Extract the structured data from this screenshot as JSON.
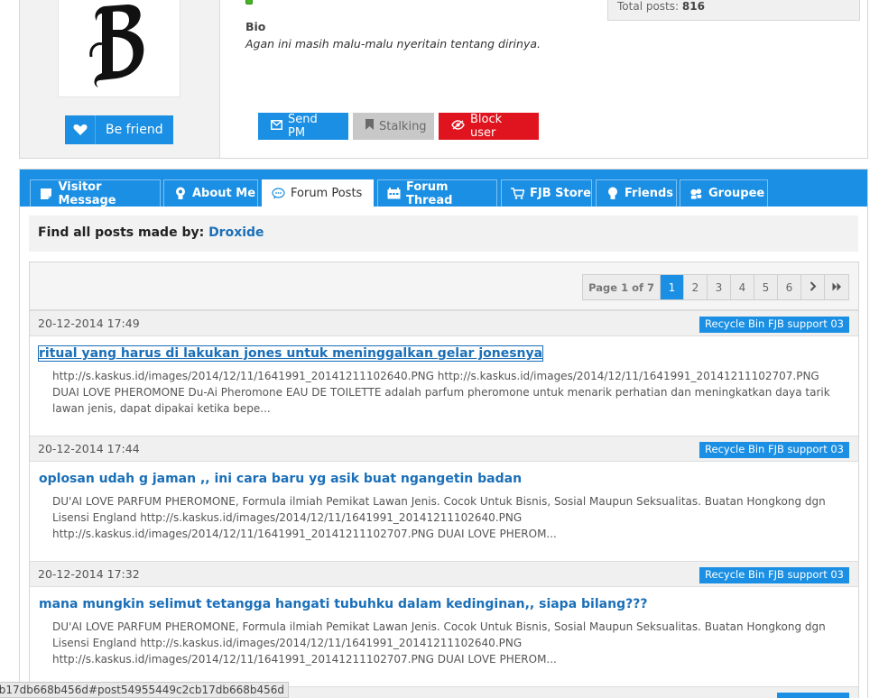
{
  "profile": {
    "bio_label": "Bio",
    "bio_text": "Agan ini masih malu-malu nyeritain tentang dirinya.",
    "stats_label": "Total posts:",
    "stats_value": "816",
    "befriend_label": "Be friend",
    "actions": {
      "send_pm": "Send PM",
      "stalking": "Stalking",
      "block_user": "Block user"
    }
  },
  "tabs": [
    {
      "label": "Visitor Message",
      "icon": "note-icon"
    },
    {
      "label": "About Me",
      "icon": "bulb-icon"
    },
    {
      "label": "Forum Posts",
      "icon": "chat-icon",
      "active": true
    },
    {
      "label": "Forum Thread",
      "icon": "thread-icon"
    },
    {
      "label": "FJB Store",
      "icon": "cart-icon"
    },
    {
      "label": "Friends",
      "icon": "bulb-icon"
    },
    {
      "label": "Groupee",
      "icon": "group-icon"
    }
  ],
  "find": {
    "label": "Find all posts made by:",
    "user": "Droxide"
  },
  "pager": {
    "info": "Page 1 of 7",
    "pages": [
      "1",
      "2",
      "3",
      "4",
      "5",
      "6"
    ],
    "current": "1",
    "next_icon": "chevron-right-icon",
    "last_icon": "double-chevron-right-icon"
  },
  "posts": [
    {
      "date": "20-12-2014 17:49",
      "forum": "Recycle Bin FJB support 03",
      "title": "ritual yang harus di lakukan jones untuk meninggalkan gelar jonesnya",
      "snippet": "http://s.kaskus.id/images/2014/12/11/1641991_20141211102640.PNG http://s.kaskus.id/images/2014/12/11/1641991_20141211102707.PNG DUAI LOVE PHEROMONE Du-Ai Pheromone EAU DE TOILETTE adalah parfum pheromone untuk menarik perhatian dan meningkatkan daya tarik lawan jenis, dapat dipakai ketika bepe..."
    },
    {
      "date": "20-12-2014 17:44",
      "forum": "Recycle Bin FJB support 03",
      "title": "oplosan udah g jaman ,, ini cara baru yg asik buat ngangetin badan",
      "snippet": "DU'AI LOVE PARFUM PHEROMONE, Formula ilmiah Pemikat Lawan Jenis. Cocok Untuk Bisnis, Sosial Maupun Seksualitas. Buatan Hongkong dgn Lisensi England http://s.kaskus.id/images/2014/12/11/1641991_20141211102640.PNG http://s.kaskus.id/images/2014/12/11/1641991_20141211102707.PNG DUAI LOVE PHEROM..."
    },
    {
      "date": "20-12-2014 17:32",
      "forum": "Recycle Bin FJB support 03",
      "title": "mana mungkin selimut tetangga hangati tubuhku dalam kedinginan,, siapa bilang???",
      "snippet": "DU'AI LOVE PARFUM PHEROMONE, Formula ilmiah Pemikat Lawan Jenis. Cocok Untuk Bisnis, Sosial Maupun Seksualitas. Buatan Hongkong dgn Lisensi England http://s.kaskus.id/images/2014/12/11/1641991_20141211102640.PNG http://s.kaskus.id/images/2014/12/11/1641991_20141211102707.PNG DUAI LOVE PHEROM..."
    }
  ],
  "status_url": "54955449c2cb17db668b456d#post54955449c2cb17db668b456d",
  "colors": {
    "accent": "#1a8fe3",
    "danger": "#e0141e",
    "link": "#1a6fb8"
  }
}
